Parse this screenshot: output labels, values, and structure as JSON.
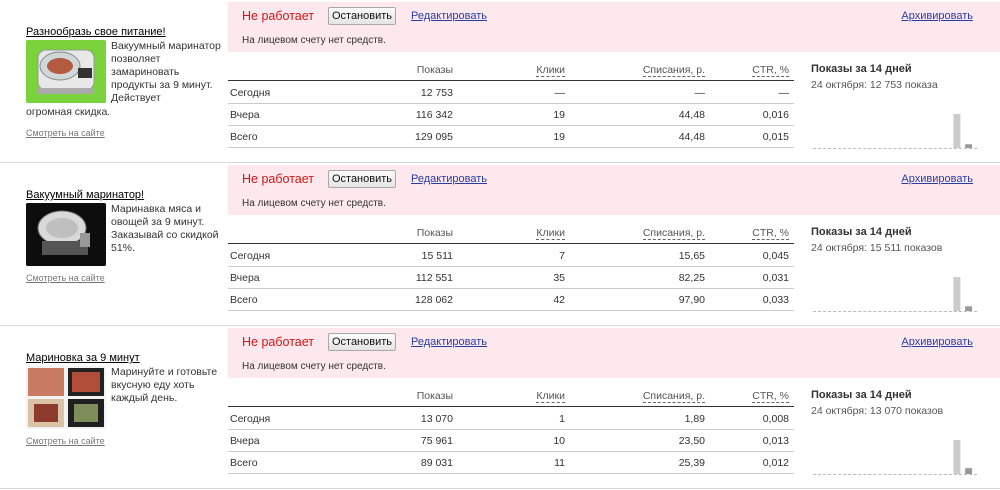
{
  "ads": [
    {
      "title": "Разнообразь свое питание!",
      "thumb_icon": "vacuum-marinator-photo-green",
      "text": "Вакуумный маринатор позволяет замариновать продукты за 9 минут. Действует",
      "text_cont": "огромная скидка.",
      "site_link": "Смотреть на сайте",
      "status": "Не работает",
      "stop_label": "Остановить",
      "edit_label": "Редактировать",
      "archive_label": "Архивировать",
      "note": "На лицевом счету нет средств.",
      "headers": {
        "shows": "Показы",
        "clicks": "Клики",
        "spent": "Списания, р.",
        "ctr": "CTR, %"
      },
      "rows": [
        {
          "label": "Сегодня",
          "shows": "12 753",
          "clicks": "—",
          "spent": "—",
          "ctr": "—"
        },
        {
          "label": "Вчера",
          "shows": "116 342",
          "clicks": "19",
          "spent": "44,48",
          "ctr": "0,016"
        },
        {
          "label": "Всего",
          "shows": "129 095",
          "clicks": "19",
          "spent": "44,48",
          "ctr": "0,015"
        }
      ],
      "chart_title": "Показы за 14 дней",
      "chart_sub": "24 октября: 12 753 показа",
      "chart_data": {
        "type": "bar",
        "values": [
          0,
          0,
          0,
          0,
          0,
          0,
          0,
          0,
          0,
          0,
          0,
          0,
          116342,
          12753
        ],
        "ylim": [
          0,
          116342
        ]
      }
    },
    {
      "title": "Вакуумный маринатор!",
      "thumb_icon": "vacuum-marinator-photo-dark",
      "text": "Маринавка мяса и овощей за 9 минут. Заказывай со скидкой 51%.",
      "text_cont": "",
      "site_link": "Смотреть на сайте",
      "status": "Не работает",
      "stop_label": "Остановить",
      "edit_label": "Редактировать",
      "archive_label": "Архивировать",
      "note": "На лицевом счету нет средств.",
      "headers": {
        "shows": "Показы",
        "clicks": "Клики",
        "spent": "Списания, р.",
        "ctr": "CTR, %"
      },
      "rows": [
        {
          "label": "Сегодня",
          "shows": "15 511",
          "clicks": "7",
          "spent": "15,65",
          "ctr": "0,045"
        },
        {
          "label": "Вчера",
          "shows": "112 551",
          "clicks": "35",
          "spent": "82,25",
          "ctr": "0,031"
        },
        {
          "label": "Всего",
          "shows": "128 062",
          "clicks": "42",
          "spent": "97,90",
          "ctr": "0,033"
        }
      ],
      "chart_title": "Показы за 14 дней",
      "chart_sub": "24 октября: 15 511 показов",
      "chart_data": {
        "type": "bar",
        "values": [
          0,
          0,
          0,
          0,
          0,
          0,
          0,
          0,
          0,
          0,
          0,
          0,
          112551,
          15511
        ],
        "ylim": [
          0,
          112551
        ]
      }
    },
    {
      "title": "Мариновка за 9 минут",
      "thumb_icon": "marinated-food-photo-collage",
      "text": "Маринуйте и готовьте вкусную еду хоть каждый день.",
      "text_cont": "",
      "site_link": "Смотреть на сайте",
      "status": "Не работает",
      "stop_label": "Остановить",
      "edit_label": "Редактировать",
      "archive_label": "Архивировать",
      "note": "На лицевом счету нет средств.",
      "headers": {
        "shows": "Показы",
        "clicks": "Клики",
        "spent": "Списания, р.",
        "ctr": "CTR, %"
      },
      "rows": [
        {
          "label": "Сегодня",
          "shows": "13 070",
          "clicks": "1",
          "spent": "1,89",
          "ctr": "0,008"
        },
        {
          "label": "Вчера",
          "shows": "75 961",
          "clicks": "10",
          "spent": "23,50",
          "ctr": "0,013"
        },
        {
          "label": "Всего",
          "shows": "89 031",
          "clicks": "11",
          "spent": "25,39",
          "ctr": "0,012"
        }
      ],
      "chart_title": "Показы за 14 дней",
      "chart_sub": "24 октября: 13 070 показов",
      "chart_data": {
        "type": "bar",
        "values": [
          0,
          0,
          0,
          0,
          0,
          0,
          0,
          0,
          0,
          0,
          0,
          0,
          75961,
          13070
        ],
        "ylim": [
          0,
          75961
        ]
      }
    }
  ]
}
